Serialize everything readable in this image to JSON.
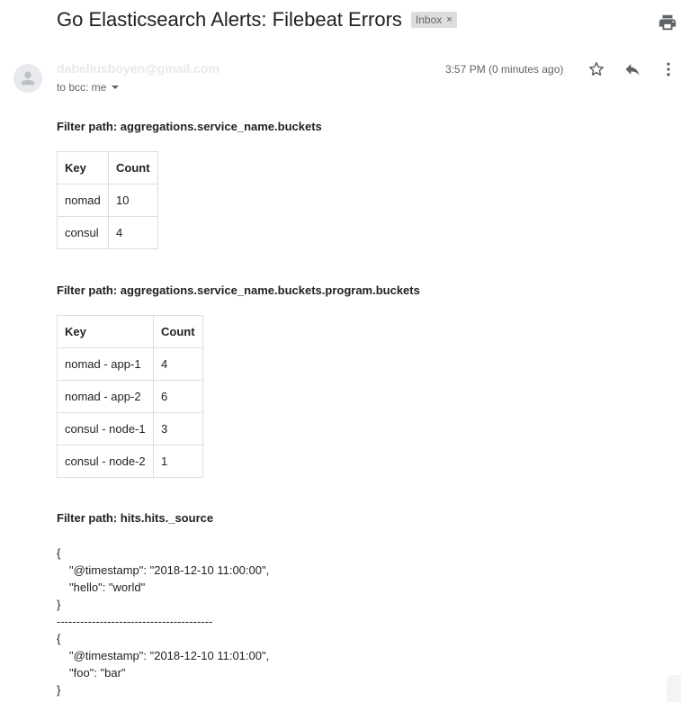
{
  "email": {
    "subject": "Go Elasticsearch Alerts: Filebeat Errors",
    "label": "Inbox",
    "label_remove": "×",
    "sender": "dabeliusboyen@gmail.com",
    "recipients": "to bcc: me",
    "time": "3:57 PM (0 minutes ago)"
  },
  "icons": {
    "print": "print-icon",
    "star": "star-icon",
    "reply": "reply-icon",
    "more": "more-vert-icon",
    "avatar": "person-icon"
  },
  "body": {
    "section1": {
      "heading": "Filter path: aggregations.service_name.buckets",
      "columns": [
        "Key",
        "Count"
      ],
      "rows": [
        [
          "nomad",
          "10"
        ],
        [
          "consul",
          "4"
        ]
      ]
    },
    "section2": {
      "heading": "Filter path: aggregations.service_name.buckets.program.buckets",
      "columns": [
        "Key",
        "Count"
      ],
      "rows": [
        [
          "nomad - app-1",
          "4"
        ],
        [
          "nomad - app-2",
          "6"
        ],
        [
          "consul - node-1",
          "3"
        ],
        [
          "consul - node-2",
          "1"
        ]
      ]
    },
    "section3": {
      "heading": "Filter path: hits.hits._source",
      "hit1": {
        "open": "{",
        "line1": "\"@timestamp\": \"2018-12-10 11:00:00\",",
        "line2": "\"hello\": \"world\"",
        "close": "}"
      },
      "separator": "----------------------------------------",
      "hit2": {
        "open": "{",
        "line1": "\"@timestamp\": \"2018-12-10 11:01:00\",",
        "line2": "\"foo\": \"bar\"",
        "close": "}"
      }
    }
  }
}
